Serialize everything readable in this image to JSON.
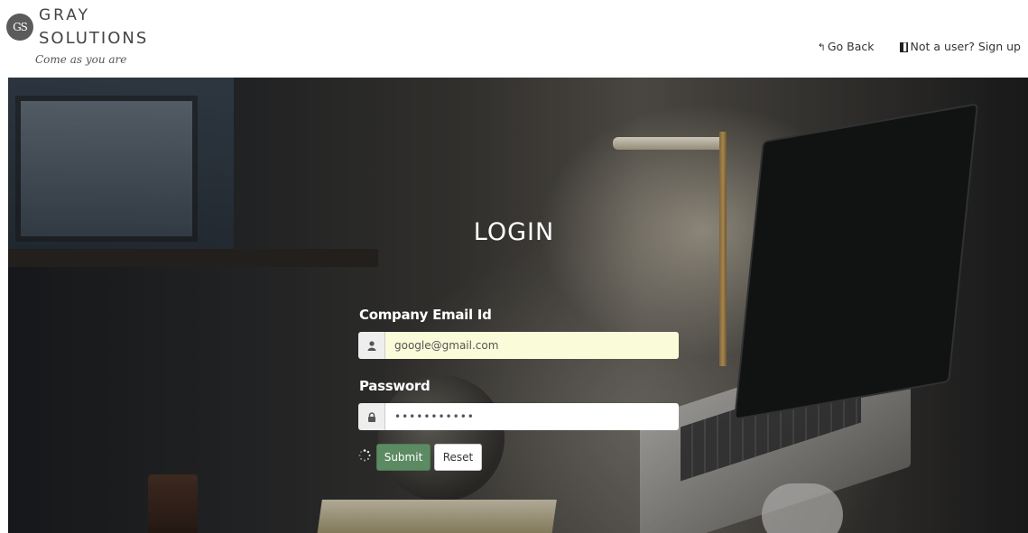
{
  "brand": {
    "mark": "GS",
    "line1": "GRAY",
    "line2": "SOLUTIONS",
    "tagline": "Come as you are"
  },
  "nav": {
    "go_back": "Go Back",
    "signup": "Not a user? Sign up",
    "go_back_icon": "reply-arrow-icon",
    "signup_icon": "id-card-icon"
  },
  "login": {
    "title": "LOGIN",
    "email_label": "Company Email Id",
    "email_value": "google@gmail.com",
    "email_icon": "user-icon",
    "password_label": "Password",
    "password_value": "•••••••••••",
    "password_icon": "lock-icon",
    "submit_label": "Submit",
    "reset_label": "Reset",
    "spinner_icon": "loading-spinner-icon"
  },
  "colors": {
    "submit_bg": "#5c8a62",
    "email_input_bg": "#fafcd9",
    "header_bg": "#ffffff",
    "title_color": "#ffffff"
  }
}
